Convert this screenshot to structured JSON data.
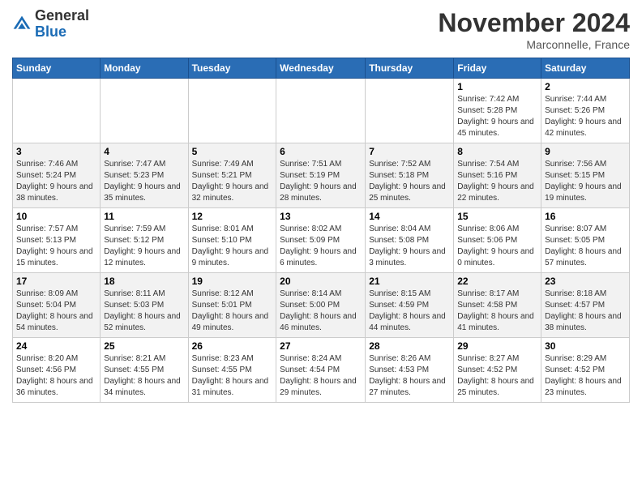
{
  "header": {
    "logo_general": "General",
    "logo_blue": "Blue",
    "month_title": "November 2024",
    "location": "Marconnelle, France"
  },
  "days_of_week": [
    "Sunday",
    "Monday",
    "Tuesday",
    "Wednesday",
    "Thursday",
    "Friday",
    "Saturday"
  ],
  "weeks": [
    [
      {
        "day": "",
        "info": ""
      },
      {
        "day": "",
        "info": ""
      },
      {
        "day": "",
        "info": ""
      },
      {
        "day": "",
        "info": ""
      },
      {
        "day": "",
        "info": ""
      },
      {
        "day": "1",
        "info": "Sunrise: 7:42 AM\nSunset: 5:28 PM\nDaylight: 9 hours and 45 minutes."
      },
      {
        "day": "2",
        "info": "Sunrise: 7:44 AM\nSunset: 5:26 PM\nDaylight: 9 hours and 42 minutes."
      }
    ],
    [
      {
        "day": "3",
        "info": "Sunrise: 7:46 AM\nSunset: 5:24 PM\nDaylight: 9 hours and 38 minutes."
      },
      {
        "day": "4",
        "info": "Sunrise: 7:47 AM\nSunset: 5:23 PM\nDaylight: 9 hours and 35 minutes."
      },
      {
        "day": "5",
        "info": "Sunrise: 7:49 AM\nSunset: 5:21 PM\nDaylight: 9 hours and 32 minutes."
      },
      {
        "day": "6",
        "info": "Sunrise: 7:51 AM\nSunset: 5:19 PM\nDaylight: 9 hours and 28 minutes."
      },
      {
        "day": "7",
        "info": "Sunrise: 7:52 AM\nSunset: 5:18 PM\nDaylight: 9 hours and 25 minutes."
      },
      {
        "day": "8",
        "info": "Sunrise: 7:54 AM\nSunset: 5:16 PM\nDaylight: 9 hours and 22 minutes."
      },
      {
        "day": "9",
        "info": "Sunrise: 7:56 AM\nSunset: 5:15 PM\nDaylight: 9 hours and 19 minutes."
      }
    ],
    [
      {
        "day": "10",
        "info": "Sunrise: 7:57 AM\nSunset: 5:13 PM\nDaylight: 9 hours and 15 minutes."
      },
      {
        "day": "11",
        "info": "Sunrise: 7:59 AM\nSunset: 5:12 PM\nDaylight: 9 hours and 12 minutes."
      },
      {
        "day": "12",
        "info": "Sunrise: 8:01 AM\nSunset: 5:10 PM\nDaylight: 9 hours and 9 minutes."
      },
      {
        "day": "13",
        "info": "Sunrise: 8:02 AM\nSunset: 5:09 PM\nDaylight: 9 hours and 6 minutes."
      },
      {
        "day": "14",
        "info": "Sunrise: 8:04 AM\nSunset: 5:08 PM\nDaylight: 9 hours and 3 minutes."
      },
      {
        "day": "15",
        "info": "Sunrise: 8:06 AM\nSunset: 5:06 PM\nDaylight: 9 hours and 0 minutes."
      },
      {
        "day": "16",
        "info": "Sunrise: 8:07 AM\nSunset: 5:05 PM\nDaylight: 8 hours and 57 minutes."
      }
    ],
    [
      {
        "day": "17",
        "info": "Sunrise: 8:09 AM\nSunset: 5:04 PM\nDaylight: 8 hours and 54 minutes."
      },
      {
        "day": "18",
        "info": "Sunrise: 8:11 AM\nSunset: 5:03 PM\nDaylight: 8 hours and 52 minutes."
      },
      {
        "day": "19",
        "info": "Sunrise: 8:12 AM\nSunset: 5:01 PM\nDaylight: 8 hours and 49 minutes."
      },
      {
        "day": "20",
        "info": "Sunrise: 8:14 AM\nSunset: 5:00 PM\nDaylight: 8 hours and 46 minutes."
      },
      {
        "day": "21",
        "info": "Sunrise: 8:15 AM\nSunset: 4:59 PM\nDaylight: 8 hours and 44 minutes."
      },
      {
        "day": "22",
        "info": "Sunrise: 8:17 AM\nSunset: 4:58 PM\nDaylight: 8 hours and 41 minutes."
      },
      {
        "day": "23",
        "info": "Sunrise: 8:18 AM\nSunset: 4:57 PM\nDaylight: 8 hours and 38 minutes."
      }
    ],
    [
      {
        "day": "24",
        "info": "Sunrise: 8:20 AM\nSunset: 4:56 PM\nDaylight: 8 hours and 36 minutes."
      },
      {
        "day": "25",
        "info": "Sunrise: 8:21 AM\nSunset: 4:55 PM\nDaylight: 8 hours and 34 minutes."
      },
      {
        "day": "26",
        "info": "Sunrise: 8:23 AM\nSunset: 4:55 PM\nDaylight: 8 hours and 31 minutes."
      },
      {
        "day": "27",
        "info": "Sunrise: 8:24 AM\nSunset: 4:54 PM\nDaylight: 8 hours and 29 minutes."
      },
      {
        "day": "28",
        "info": "Sunrise: 8:26 AM\nSunset: 4:53 PM\nDaylight: 8 hours and 27 minutes."
      },
      {
        "day": "29",
        "info": "Sunrise: 8:27 AM\nSunset: 4:52 PM\nDaylight: 8 hours and 25 minutes."
      },
      {
        "day": "30",
        "info": "Sunrise: 8:29 AM\nSunset: 4:52 PM\nDaylight: 8 hours and 23 minutes."
      }
    ]
  ]
}
